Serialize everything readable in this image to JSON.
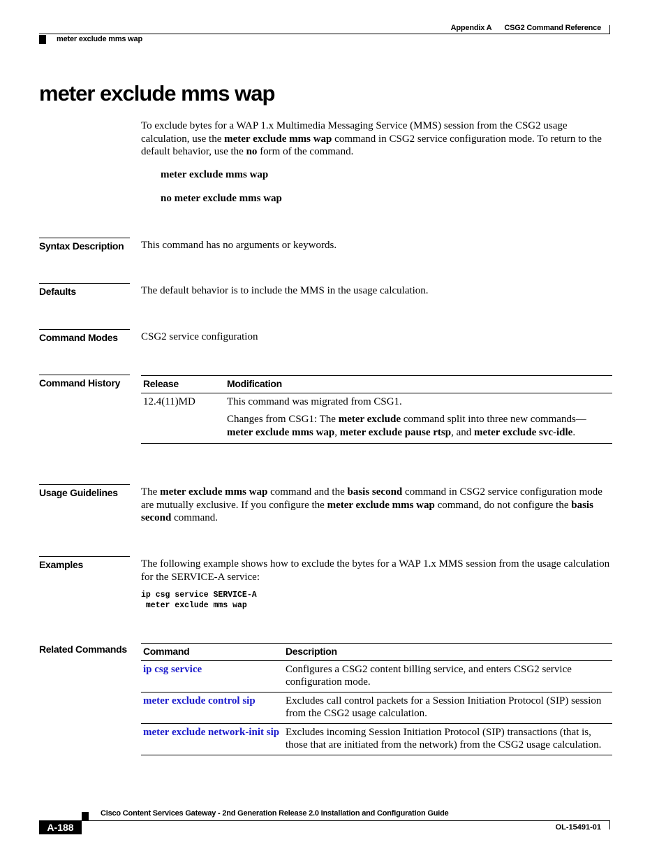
{
  "header": {
    "appendix": "Appendix A",
    "chapter": "CSG2 Command Reference",
    "running_title": "meter exclude mms wap"
  },
  "title": "meter exclude mms wap",
  "intro": {
    "p1": "To exclude bytes for a WAP 1.x Multimedia Messaging Service (MMS) session from the CSG2 usage calculation, use the ",
    "cmd": "meter exclude mms wap",
    "p2": " command in CSG2 service configuration mode. To return to the default behavior, use the ",
    "no": "no",
    "p3": " form of the command."
  },
  "syntax": {
    "line1": "meter exclude mms wap",
    "line2": "no meter exclude mms wap"
  },
  "sections": {
    "syntax_description": {
      "label": "Syntax Description",
      "text": "This command has no arguments or keywords."
    },
    "defaults": {
      "label": "Defaults",
      "text": "The default behavior is to include the MMS in the usage calculation."
    },
    "command_modes": {
      "label": "Command Modes",
      "text": "CSG2 service configuration"
    },
    "command_history": {
      "label": "Command History",
      "headers": [
        "Release",
        "Modification"
      ],
      "release": "12.4(11)MD",
      "mod1": "This command was migrated from CSG1.",
      "mod2": {
        "t1": "Changes from CSG1: The ",
        "b1": "meter exclude",
        "t2": " command split into three new commands—",
        "b2": "meter exclude mms wap",
        "t3": ", ",
        "b3": "meter exclude pause rtsp",
        "t4": ", and ",
        "b4": "meter exclude svc-idle",
        "t5": "."
      }
    },
    "usage_guidelines": {
      "label": "Usage Guidelines",
      "t1": "The ",
      "b1": "meter exclude mms wap",
      "t2": " command and the ",
      "b2": "basis second",
      "t3": " command in CSG2 service configuration mode are mutually exclusive. If you configure the ",
      "b3": "meter exclude mms wap",
      "t4": " command, do not configure the ",
      "b4": "basis second",
      "t5": " command."
    },
    "examples": {
      "label": "Examples",
      "text": "The following example shows how to exclude the bytes for a WAP 1.x MMS session from the usage calculation for the SERVICE-A service:",
      "code": "ip csg service SERVICE-A\n meter exclude mms wap"
    },
    "related_commands": {
      "label": "Related Commands",
      "headers": [
        "Command",
        "Description"
      ],
      "rows": [
        {
          "command": "ip csg service",
          "description": "Configures a CSG2 content billing service, and enters CSG2 service configuration mode."
        },
        {
          "command": "meter exclude control sip",
          "description": "Excludes call control packets for a Session Initiation Protocol (SIP) session from the CSG2 usage calculation."
        },
        {
          "command": "meter exclude network-init sip",
          "description": "Excludes incoming Session Initiation Protocol (SIP) transactions (that is, those that are initiated from the network) from the CSG2 usage calculation."
        }
      ]
    }
  },
  "footer": {
    "guide_title": "Cisco Content Services Gateway - 2nd Generation Release 2.0 Installation and Configuration Guide",
    "page": "A-188",
    "doc_number": "OL-15491-01"
  },
  "colors": {
    "link": "#1a1acc",
    "text": "#000000"
  }
}
